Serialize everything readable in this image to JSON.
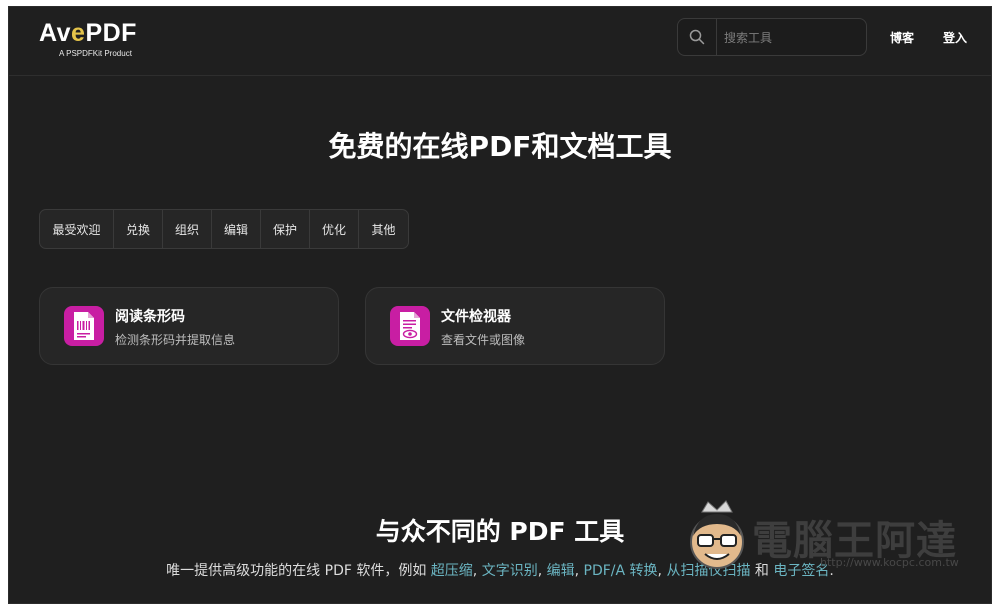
{
  "header": {
    "logo": {
      "part1": "Av",
      "accent": "e",
      "part2": "PDF",
      "tagline": "A PSPDFKit Product"
    },
    "search": {
      "placeholder": "搜索工具"
    },
    "nav": {
      "blog": "博客",
      "login": "登入"
    }
  },
  "hero": {
    "title": "免费的在线PDF和文档工具"
  },
  "tabs": [
    {
      "label": "最受欢迎"
    },
    {
      "label": "兑换"
    },
    {
      "label": "组织"
    },
    {
      "label": "编辑"
    },
    {
      "label": "保护"
    },
    {
      "label": "优化"
    },
    {
      "label": "其他"
    }
  ],
  "cards": [
    {
      "title": "阅读条形码",
      "desc": "检测条形码并提取信息",
      "icon": "barcode-document-icon"
    },
    {
      "title": "文件检视器",
      "desc": "查看文件或图像",
      "icon": "document-eye-icon"
    }
  ],
  "section": {
    "title": "与众不同的 PDF 工具",
    "desc_prefix": "唯一提供高级功能的在线 PDF 软件，例如 ",
    "links": [
      "超压缩",
      "文字识别",
      "编辑",
      "PDF/A 转换",
      "从扫描仪扫描",
      "电子签名"
    ],
    "sep1": ", ",
    "sep2": ", ",
    "sep3": ", ",
    "sep4": ", ",
    "and": " 和 ",
    "end": "."
  },
  "watermark": {
    "text": "電腦王阿達",
    "url": "http://www.kocpc.com.tw"
  },
  "colors": {
    "background": "#1f1f1f",
    "card": "#262626",
    "icon_bg": "#c81ea3",
    "link": "#6bb5c2",
    "logo_accent": "#e5c44a"
  }
}
